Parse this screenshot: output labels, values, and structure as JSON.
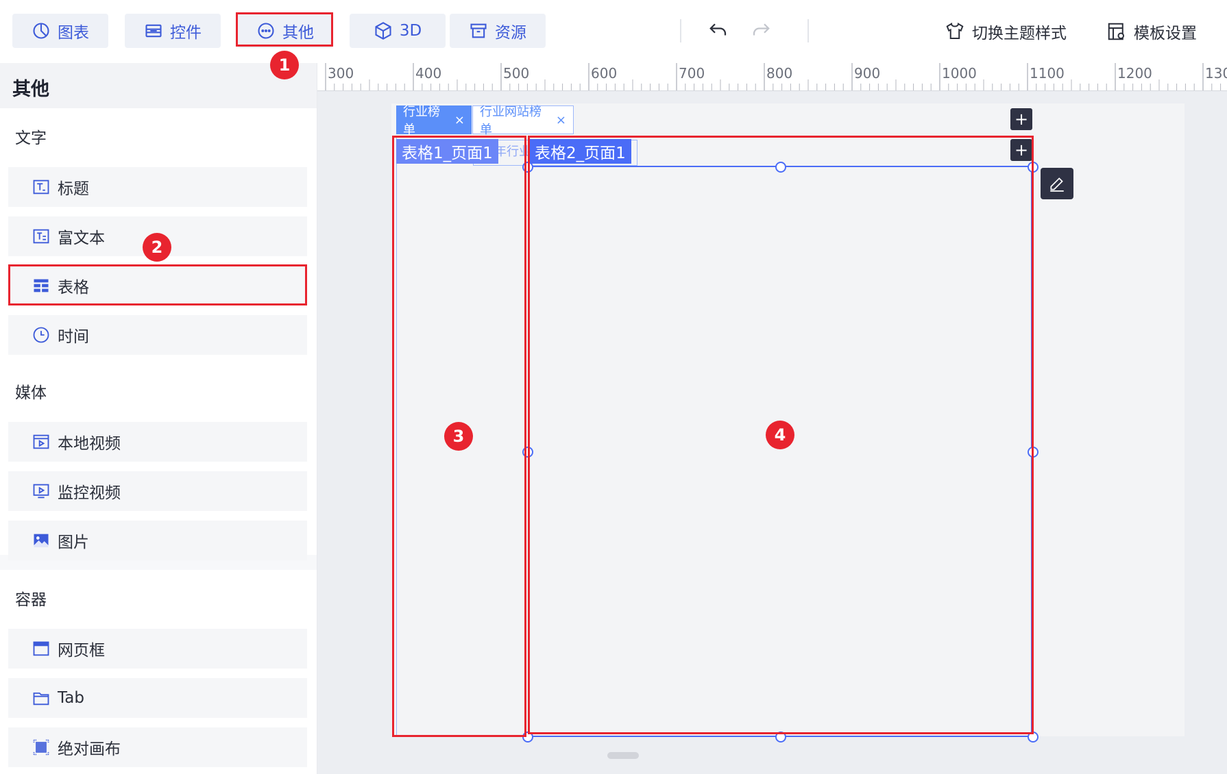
{
  "toolbar": {
    "buttons": [
      {
        "label": "图表",
        "icon": "chart-pie-icon"
      },
      {
        "label": "控件",
        "icon": "widget-icon"
      },
      {
        "label": "其他",
        "icon": "more-circle-icon"
      },
      {
        "label": "3D",
        "icon": "cube-icon"
      },
      {
        "label": "资源",
        "icon": "archive-icon"
      }
    ],
    "theme_label": "切换主题样式",
    "template_label": "模板设置"
  },
  "panel": {
    "title": "其他",
    "sections": [
      {
        "label": "文字",
        "items": [
          "标题",
          "富文本",
          "表格",
          "时间"
        ]
      },
      {
        "label": "媒体",
        "items": [
          "本地视频",
          "监控视频",
          "图片"
        ]
      },
      {
        "label": "容器",
        "items": [
          "网页框",
          "Tab",
          "绝对画布"
        ]
      }
    ]
  },
  "ruler": {
    "labels": [
      "300",
      "400",
      "500",
      "600",
      "700",
      "800",
      "900",
      "1000",
      "1100",
      "1200",
      "130"
    ]
  },
  "canvas": {
    "tabs": [
      {
        "label": "行业榜单",
        "close": "×"
      },
      {
        "label": "行业网站榜单",
        "close": "×"
      }
    ],
    "plus_symbol": "+",
    "table1_tag": "表格1_页面1",
    "table1_behind_text": "年行业",
    "table2_tag": "表格2_页面1"
  },
  "annotations": [
    "1",
    "2",
    "3",
    "4"
  ],
  "colors": {
    "accent": "#3d5bd9",
    "annotation_red": "#e8242f",
    "tag_blue": "#4a6cf7",
    "tab_active": "#5b8ff9"
  }
}
